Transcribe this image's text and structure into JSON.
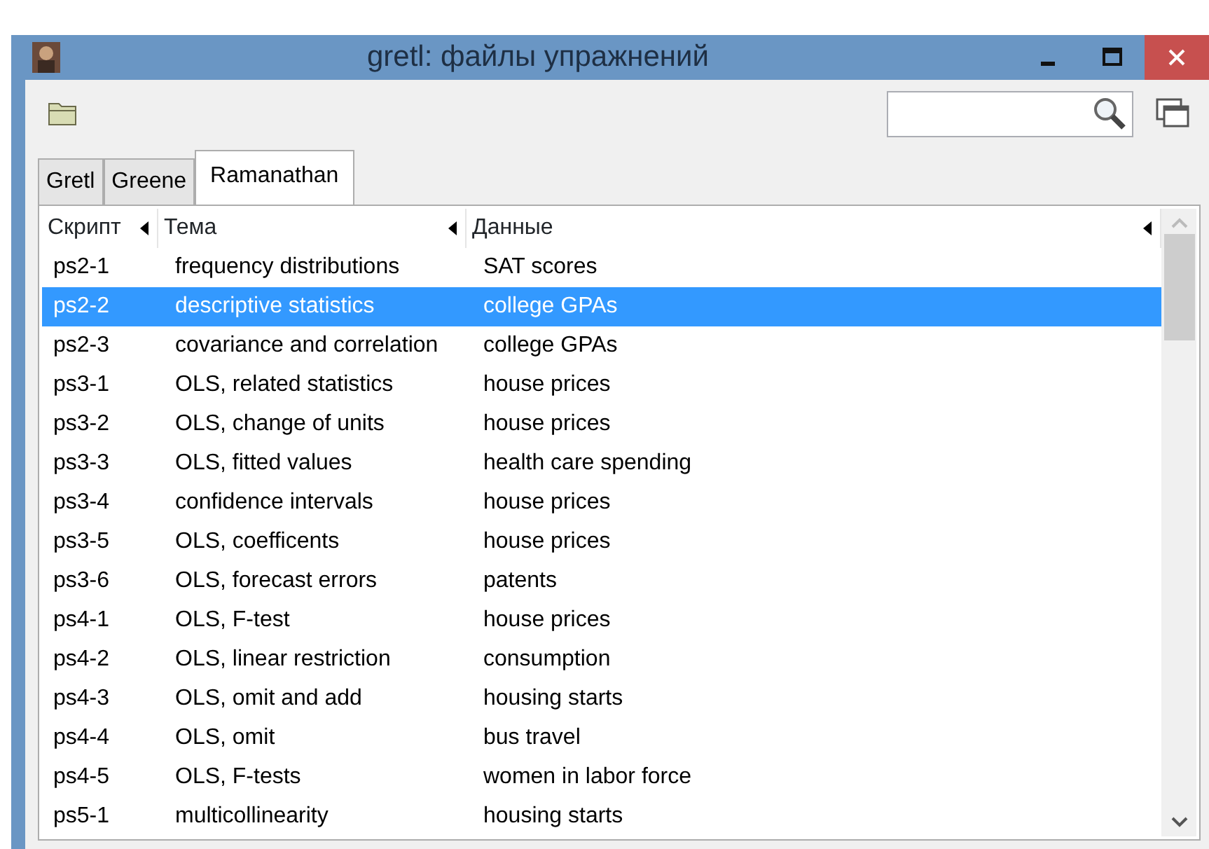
{
  "window": {
    "title": "gretl: файлы упражнений"
  },
  "tabs": [
    {
      "label": "Gretl",
      "selected": false
    },
    {
      "label": "Greene",
      "selected": false
    },
    {
      "label": "Ramanathan",
      "selected": true
    }
  ],
  "table": {
    "columns": [
      "Скрипт",
      "Тема",
      "Данные"
    ],
    "rows": [
      {
        "cells": [
          "ps2-1",
          "frequency distributions",
          "SAT scores"
        ],
        "selected": false
      },
      {
        "cells": [
          "ps2-2",
          "descriptive statistics",
          "college GPAs"
        ],
        "selected": true
      },
      {
        "cells": [
          "ps2-3",
          "covariance and correlation",
          "college GPAs"
        ],
        "selected": false
      },
      {
        "cells": [
          "ps3-1",
          "OLS, related statistics",
          "house prices"
        ],
        "selected": false
      },
      {
        "cells": [
          "ps3-2",
          "OLS, change of units",
          "house prices"
        ],
        "selected": false
      },
      {
        "cells": [
          "ps3-3",
          "OLS, fitted values",
          "health care spending"
        ],
        "selected": false
      },
      {
        "cells": [
          "ps3-4",
          "confidence intervals",
          "house prices"
        ],
        "selected": false
      },
      {
        "cells": [
          "ps3-5",
          "OLS, coefficents",
          "house prices"
        ],
        "selected": false
      },
      {
        "cells": [
          "ps3-6",
          "OLS, forecast errors",
          "patents"
        ],
        "selected": false
      },
      {
        "cells": [
          "ps4-1",
          "OLS, F-test",
          "house prices"
        ],
        "selected": false
      },
      {
        "cells": [
          "ps4-2",
          "OLS, linear restriction",
          "consumption"
        ],
        "selected": false
      },
      {
        "cells": [
          "ps4-3",
          "OLS, omit and add",
          "housing starts"
        ],
        "selected": false
      },
      {
        "cells": [
          "ps4-4",
          "OLS, omit",
          "bus travel"
        ],
        "selected": false
      },
      {
        "cells": [
          "ps4-5",
          "OLS, F-tests",
          "women in labor force"
        ],
        "selected": false
      },
      {
        "cells": [
          "ps5-1",
          "multicollinearity",
          "housing starts"
        ],
        "selected": false
      }
    ]
  }
}
